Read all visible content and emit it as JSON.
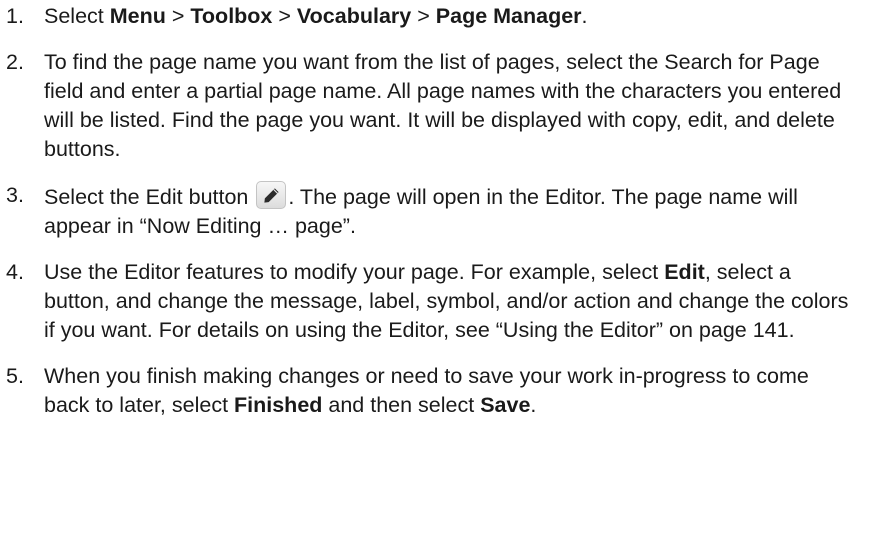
{
  "steps": [
    {
      "number": "1.",
      "parts": [
        "Select ",
        "Menu",
        " > ",
        "Toolbox",
        " > ",
        "Vocabulary",
        " > ",
        "Page Manager",
        "."
      ]
    },
    {
      "number": "2.",
      "text": "To find the page name you want from the list of pages, select the Search for Page field and enter a partial page name. All page names with the characters you entered will be listed. Find the page you want. It will be displayed with copy, edit, and delete buttons."
    },
    {
      "number": "3.",
      "before_icon": "Select the Edit button",
      "icon": "pencil-icon",
      "after_icon": ". The page will open in the Editor. The page name will appear in “Now Editing … page”."
    },
    {
      "number": "4.",
      "parts": [
        "Use the Editor features to modify your page. For example, select ",
        "Edit",
        ", select a button, and change the message, label, symbol, and/or action and change the colors if you want. For details on using the Editor, see “Using the Editor” on page 141."
      ]
    },
    {
      "number": "5.",
      "parts": [
        "When you finish making changes or need to save your work in-progress to come back to later, select ",
        "Finished",
        " and then select ",
        "Save",
        "."
      ]
    }
  ]
}
